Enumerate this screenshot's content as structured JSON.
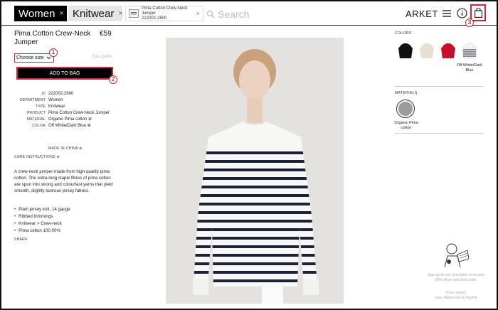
{
  "header": {
    "chips": [
      {
        "label": "Women",
        "close": "×"
      },
      {
        "label": "Knitwear",
        "close": "×"
      }
    ],
    "item_chip": {
      "title": "Pima Cotton Crew-Neck Jumper",
      "code": "222002-2600",
      "close": "×"
    },
    "search_placeholder": "Search",
    "brand": "ARKET"
  },
  "annotations": {
    "one": "1",
    "two": "2",
    "three": "3"
  },
  "product": {
    "title": "Pima Cotton Crew-Neck Jumper",
    "price": "€59",
    "size_button": "Choose size",
    "size_guide": "Size guide",
    "add_to_bag": "ADD TO BAG",
    "specs": [
      {
        "key": "ID",
        "value": "222002-2600"
      },
      {
        "key": "DEPARTMENT",
        "value": "Women"
      },
      {
        "key": "TYPE",
        "value": "Knitwear"
      },
      {
        "key": "PRODUCT",
        "value": "Pima Cotton Crew-Neck Jumper"
      },
      {
        "key": "MATERIAL",
        "value": "Organic Pima cotton ⊕"
      },
      {
        "key": "COLOR",
        "value": "Off White/Dark Blue ⊕"
      }
    ],
    "made_in": "MADE IN CHINA ⊕",
    "care": "CARE INSTRUCTIONS ⊕",
    "description": "A crew-neck jumper made from high-quality pima cotton. The extra-long staple fibres of pima cotton are spun into strong and colourfast yarns that yield smooth, slightly lustrous jersey fabrics.",
    "bullets": [
      "Plain jersey knit, 14 gauge",
      "Ribbed trimmings",
      "Knitwear > Crew-neck",
      "Pima cotton 100.00%"
    ],
    "share": "SHARE"
  },
  "right": {
    "colors_label": "COLORS",
    "swatch_colors": [
      "#111111",
      "#e9dfd3",
      "#c8102e",
      "#f2f2f2"
    ],
    "selected_color": "Off White/Dark Blue",
    "materials_label": "MATERIALS",
    "material": "Organic Pima cotton",
    "newsletter": "Sign up for our newsletter to receive 10% off on your first order.",
    "returns": "Free returns",
    "payment": "Visa, Mastercard & PayPal"
  },
  "colors": {
    "annotation_red": "#e0202a",
    "stripe_navy": "#1b2238"
  }
}
